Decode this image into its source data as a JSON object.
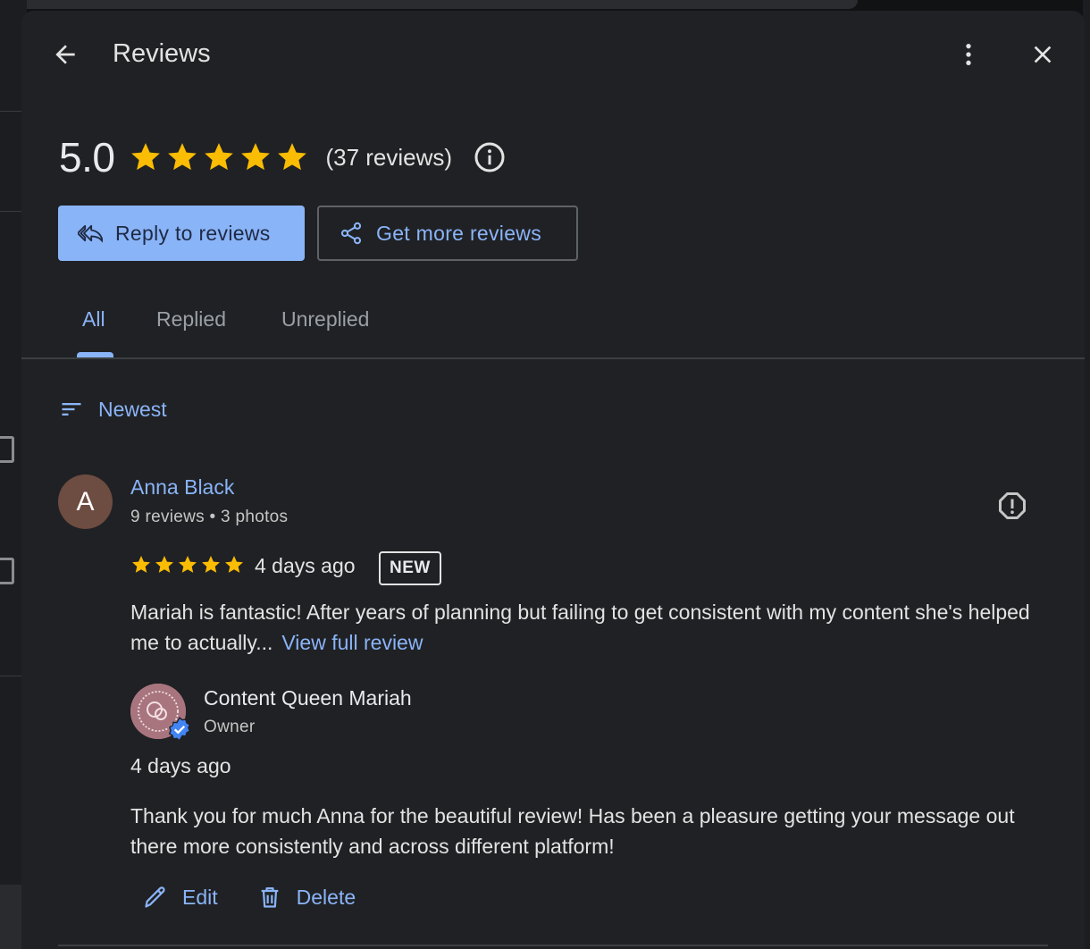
{
  "header": {
    "title": "Reviews",
    "back_icon": "arrow-back-icon",
    "more_icon": "more-vert-icon",
    "close_icon": "close-icon"
  },
  "summary": {
    "rating": "5.0",
    "stars": 5,
    "review_count": "(37 reviews)",
    "info_icon": "info-icon"
  },
  "actions": {
    "reply_label": "Reply to reviews",
    "get_more_label": "Get more reviews"
  },
  "tabs": [
    {
      "label": "All",
      "active": true
    },
    {
      "label": "Replied",
      "active": false
    },
    {
      "label": "Unreplied",
      "active": false
    }
  ],
  "sort": {
    "label": "Newest"
  },
  "review": {
    "avatar_letter": "A",
    "name": "Anna Black",
    "meta": "9 reviews • 3 photos",
    "stars": 5,
    "date": "4 days ago",
    "badge": "NEW",
    "text": "Mariah is fantastic! After years of planning but failing to get consistent with my content she's helped me to actually...",
    "view_full": "View full review",
    "reply": {
      "owner_name": "Content Queen Mariah",
      "owner_role": "Owner",
      "date": "4 days ago",
      "text": "Thank you for much Anna for the beautiful review! Has been a pleasure getting your message out there more consistently and across different platform!",
      "edit_label": "Edit",
      "delete_label": "Delete"
    }
  },
  "colors": {
    "accent": "#8ab4f8",
    "star": "#fbbc04",
    "surface": "#202124",
    "avatar": "#6d4c41"
  }
}
